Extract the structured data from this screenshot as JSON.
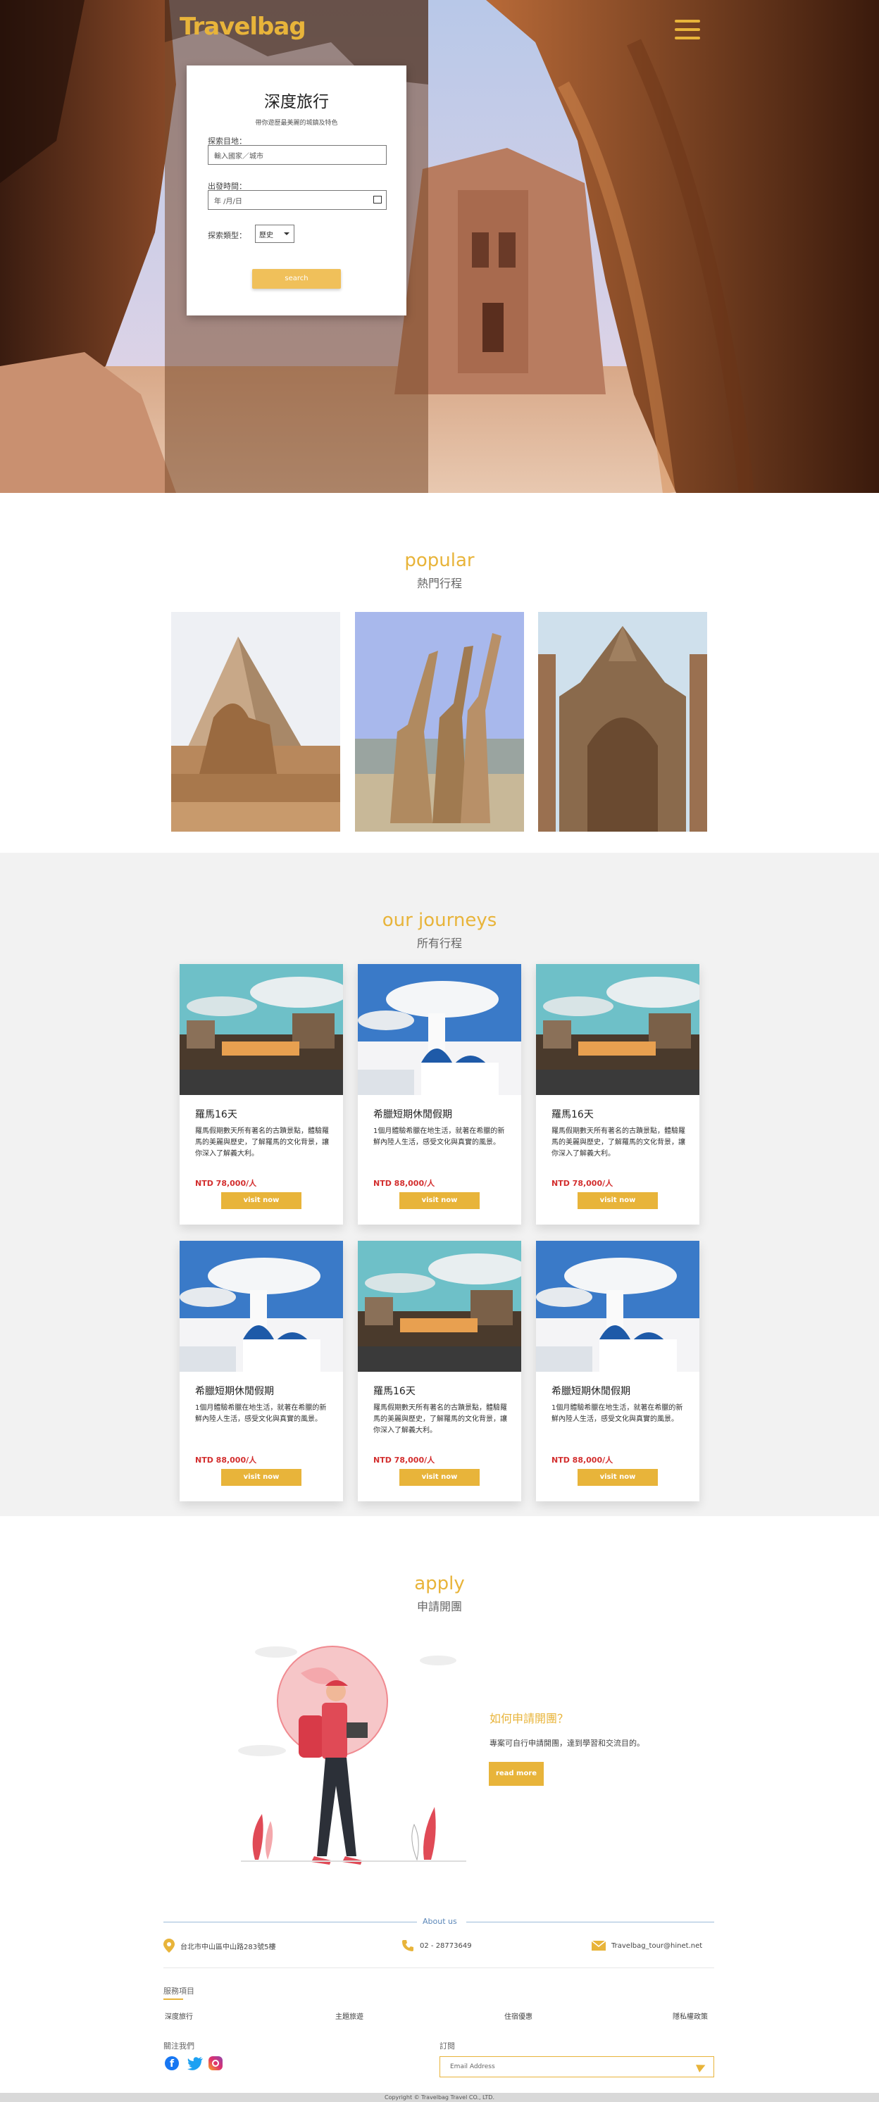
{
  "brand": {
    "logo": "Travelbag",
    "accent": "#e8b43a"
  },
  "hero": {
    "title": "深度旅行",
    "subtitle": "帶你遊歷最美麗的城鎮及特色",
    "dest_label": "探索目地：",
    "dest_placeholder": "輸入國家／城市",
    "date_label": "出發時間：",
    "date_placeholder": "年 /月/日",
    "type_label": "探索類型：",
    "type_value": "歷史",
    "search_button": "search"
  },
  "popular": {
    "en": "popular",
    "zh": "熱門行程"
  },
  "journeys": {
    "en": "our journeys",
    "zh": "所有行程",
    "cards": [
      {
        "title": "羅馬16天",
        "desc": "羅馬假期數天所有著名的古蹟景點，體驗羅馬的美麗與歷史，了解羅馬的文化背景，讓你深入了解義大利。",
        "price": "NTD 78,000/人",
        "button": "visit now"
      },
      {
        "title": "希臘短期休閒假期",
        "desc": "1個月體驗希臘在地生活，就著在希臘的新鮮內陸人生活，感受文化與真實的風景。",
        "price": "NTD 88,000/人",
        "button": "visit now"
      },
      {
        "title": "羅馬16天",
        "desc": "羅馬假期數天所有著名的古蹟景點，體驗羅馬的美麗與歷史，了解羅馬的文化背景，讓你深入了解義大利。",
        "price": "NTD 78,000/人",
        "button": "visit now"
      },
      {
        "title": "希臘短期休閒假期",
        "desc": "1個月體驗希臘在地生活，就著在希臘的新鮮內陸人生活，感受文化與真實的風景。",
        "price": "NTD 88,000/人",
        "button": "visit now"
      },
      {
        "title": "羅馬16天",
        "desc": "羅馬假期數天所有著名的古蹟景點，體驗羅馬的美麗與歷史，了解羅馬的文化背景，讓你深入了解義大利。",
        "price": "NTD 78,000/人",
        "button": "visit now"
      },
      {
        "title": "希臘短期休閒假期",
        "desc": "1個月體驗希臘在地生活，就著在希臘的新鮮內陸人生活，感受文化與真實的風景。",
        "price": "NTD 88,000/人",
        "button": "visit now"
      }
    ]
  },
  "apply": {
    "en": "apply",
    "zh": "申請開團",
    "how_title": "如何申請開團？",
    "how_desc": "專案可自行申請開團，達到學習和交流目的。",
    "read_more": "read more"
  },
  "footer": {
    "about": "About us",
    "address": "台北市中山區中山路283號5樓",
    "phone": "02 - 28773649",
    "email": "Travelbag_tour@hinet.net",
    "services_title": "服務項目",
    "services": [
      "深度旅行",
      "主題旅遊",
      "住宿優惠",
      "隱私權政策"
    ],
    "follow_title": "關注我們",
    "subscribe_title": "訂閱",
    "email_placeholder": "Email Address",
    "copyright": "Copyright © Travelbag Travel CO., LTD."
  }
}
